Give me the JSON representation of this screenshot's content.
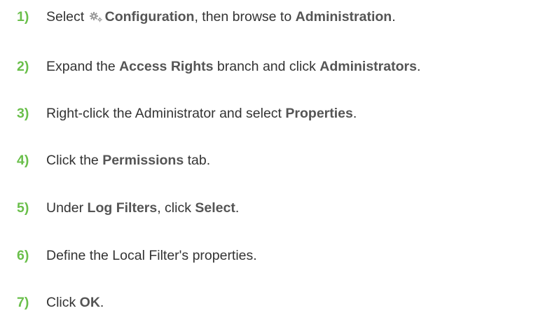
{
  "steps": [
    {
      "number": "1)",
      "parts": {
        "a": "Select",
        "icon": "gear-icon",
        "b": "Configuration",
        "c": ", then browse to",
        "d": "Administration",
        "e": "."
      }
    },
    {
      "number": "2)",
      "parts": {
        "a": "Expand the",
        "b": "Access Rights",
        "c": "branch and click",
        "d": "Administrators",
        "e": "."
      }
    },
    {
      "number": "3)",
      "parts": {
        "a": "Right-click the Administrator and select",
        "b": "Properties",
        "c": "."
      }
    },
    {
      "number": "4)",
      "parts": {
        "a": "Click the",
        "b": "Permissions",
        "c": "tab."
      }
    },
    {
      "number": "5)",
      "parts": {
        "a": "Under",
        "b": "Log Filters",
        "c": ", click",
        "d": "Select",
        "e": "."
      }
    },
    {
      "number": "6)",
      "parts": {
        "a": "Define the Local Filter's properties."
      }
    },
    {
      "number": "7)",
      "parts": {
        "a": "Click",
        "b": "OK",
        "c": "."
      }
    }
  ],
  "colors": {
    "step_number": "#6abf4b",
    "body_text": "#333333",
    "highlight_text": "#555555"
  }
}
